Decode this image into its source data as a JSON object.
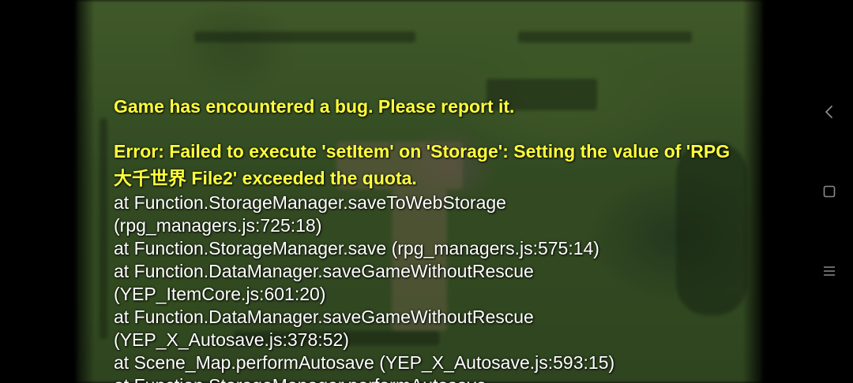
{
  "error_screen": {
    "title": "Game has encountered a bug. Please report it.",
    "message": "Error: Failed to execute 'setItem' on 'Storage': Setting the value of 'RPG 大千世界 File2' exceeded the quota.",
    "stack": [
      "at Function.StorageManager.saveToWebStorage",
      "(rpg_managers.js:725:18)",
      "at Function.StorageManager.save (rpg_managers.js:575:14)",
      "at Function.DataManager.saveGameWithoutRescue",
      "(YEP_ItemCore.js:601:20)",
      "at Function.DataManager.saveGameWithoutRescue",
      "(YEP_X_Autosave.js:378:52)",
      "at Scene_Map.performAutosave (YEP_X_Autosave.js:593:15)",
      "at Function.StorageManager.performAutosave"
    ]
  },
  "nav_bar": {
    "back_icon": "chevron-left-icon",
    "home_icon": "square-icon",
    "menu_icon": "hamburger-icon"
  },
  "colors": {
    "title_yellow": "#ffff3c",
    "stack_white": "#ffffff",
    "nav_icon_gray": "#8a8a8a",
    "background": "#000000"
  }
}
